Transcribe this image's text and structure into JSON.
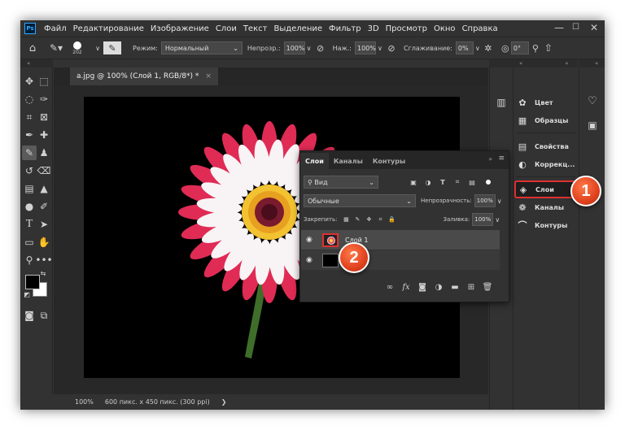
{
  "menubar": {
    "logo": "Ps",
    "items": [
      "Файл",
      "Редактирование",
      "Изображение",
      "Слои",
      "Текст",
      "Выделение",
      "Фильтр",
      "3D",
      "Просмотр",
      "Окно",
      "Справка"
    ],
    "min": "—",
    "max": "☐",
    "close": "✕"
  },
  "options": {
    "brush_size": "202",
    "mode_label": "Режим:",
    "mode_value": "Нормальный",
    "opacity_label": "Непрозр.:",
    "opacity_value": "100%",
    "pressure_label": "Наж.:",
    "pressure_value": "100%",
    "smoothing_label": "Сглаживание:",
    "smoothing_value": "0%",
    "angle_value": "0°"
  },
  "document": {
    "tab_title": "a.jpg @ 100% (Слой 1, RGB/8*) *",
    "tab_close": "×",
    "zoom": "100%",
    "size_info": "600 пикс. x 450 пикс. (300 ppi)",
    "status_arrow": "❯"
  },
  "right_panels": [
    {
      "label": "Цвет",
      "icon": "color-wheel-icon"
    },
    {
      "label": "Образцы",
      "icon": "swatches-grid-icon"
    },
    {
      "label": "Свойства",
      "icon": "properties-icon"
    },
    {
      "label": "Коррекц...",
      "icon": "adjustments-icon"
    },
    {
      "label": "Слои",
      "icon": "layers-icon"
    },
    {
      "label": "Каналы",
      "icon": "channels-icon"
    },
    {
      "label": "Контуры",
      "icon": "paths-icon"
    }
  ],
  "layers_panel": {
    "tabs": [
      "Слои",
      "Каналы",
      "Контуры"
    ],
    "filter_value": "Вид",
    "blend_mode": "Обычные",
    "opacity_label": "Непрозрачность:",
    "opacity_value": "100%",
    "lock_label": "Закрепить:",
    "fill_label": "Заливка:",
    "fill_value": "100%",
    "layers": [
      {
        "name": "Слой 1"
      },
      {
        "name": ""
      }
    ]
  },
  "badges": [
    "1",
    "2"
  ],
  "colors": {
    "highlight": "#e03030",
    "badge": "#e0421e",
    "selection": "#4a4a4a"
  }
}
